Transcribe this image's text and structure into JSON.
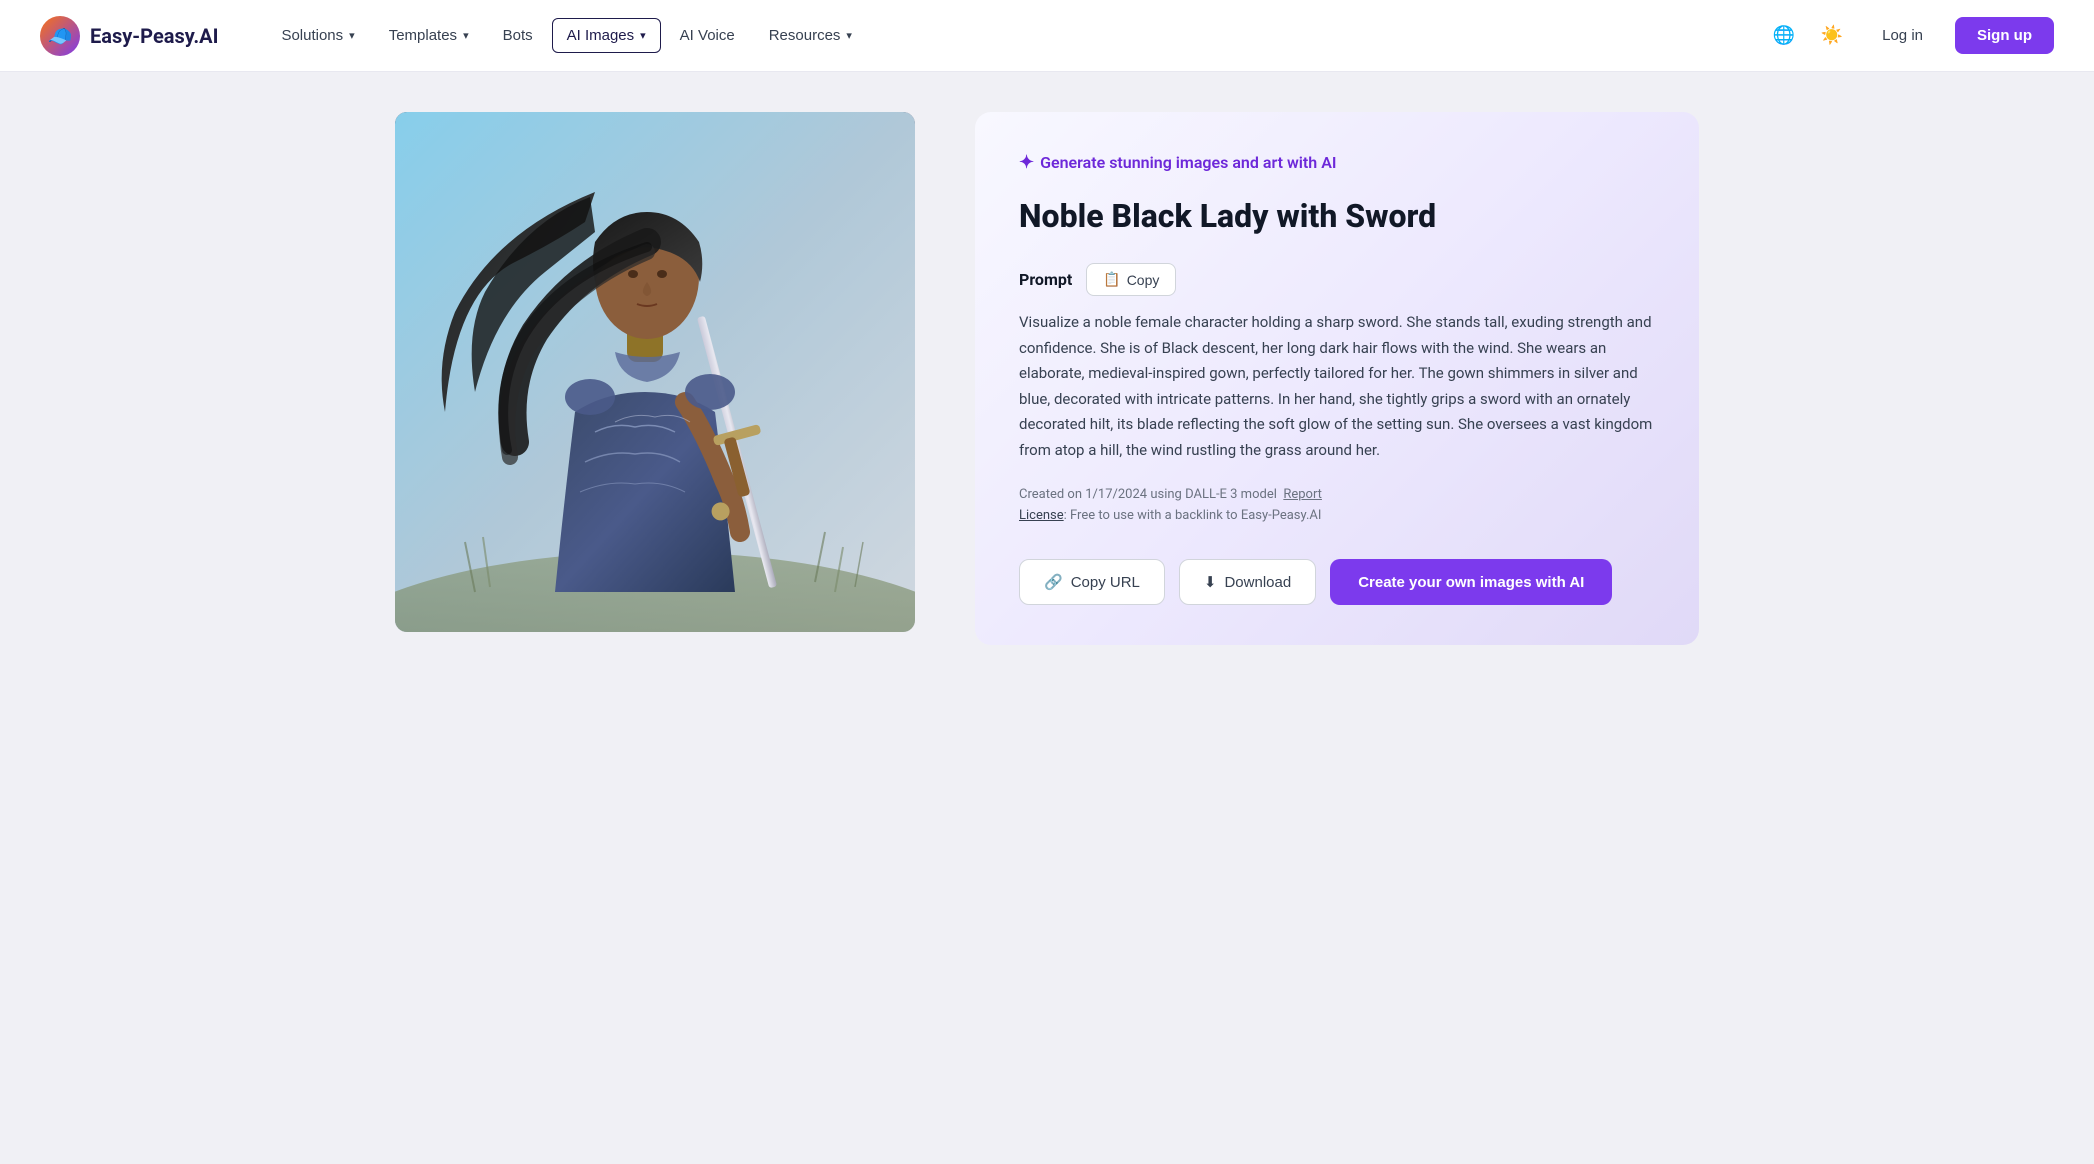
{
  "header": {
    "logo_text": "Easy-Peasy.AI",
    "logo_emoji": "🧢",
    "nav_items": [
      {
        "label": "Solutions",
        "has_dropdown": true
      },
      {
        "label": "Templates",
        "has_dropdown": true
      },
      {
        "label": "Bots",
        "has_dropdown": false
      },
      {
        "label": "AI Images",
        "has_dropdown": true,
        "active": true
      },
      {
        "label": "AI Voice",
        "has_dropdown": false
      },
      {
        "label": "Resources",
        "has_dropdown": true
      }
    ],
    "login_label": "Log in",
    "signup_label": "Sign up"
  },
  "content": {
    "generate_badge": "Generate stunning images and art with AI",
    "title": "Noble Black Lady with Sword",
    "prompt_label": "Prompt",
    "copy_label": "Copy",
    "prompt_text": "Visualize a noble female character holding a sharp sword. She stands tall, exuding strength and confidence. She is of Black descent, her long dark hair flows with the wind. She wears an elaborate, medieval-inspired gown, perfectly tailored for her. The gown shimmers in silver and blue, decorated with intricate patterns. In her hand, she tightly grips a sword with an ornately decorated hilt, its blade reflecting the soft glow of the setting sun. She oversees a vast kingdom from atop a hill, the wind rustling the grass around her.",
    "meta_created": "Created on 1/17/2024 using DALL-E 3 model",
    "meta_report": "Report",
    "license_prefix": "License",
    "license_text": "Free to use with a backlink to Easy-Peasy.AI",
    "btn_copy_url": "Copy URL",
    "btn_download": "Download",
    "btn_create": "Create your own images with AI"
  },
  "icons": {
    "copy": "📋",
    "download": "⬇",
    "link": "🔗",
    "spark": "✦",
    "globe": "🌐",
    "theme": "☀"
  }
}
